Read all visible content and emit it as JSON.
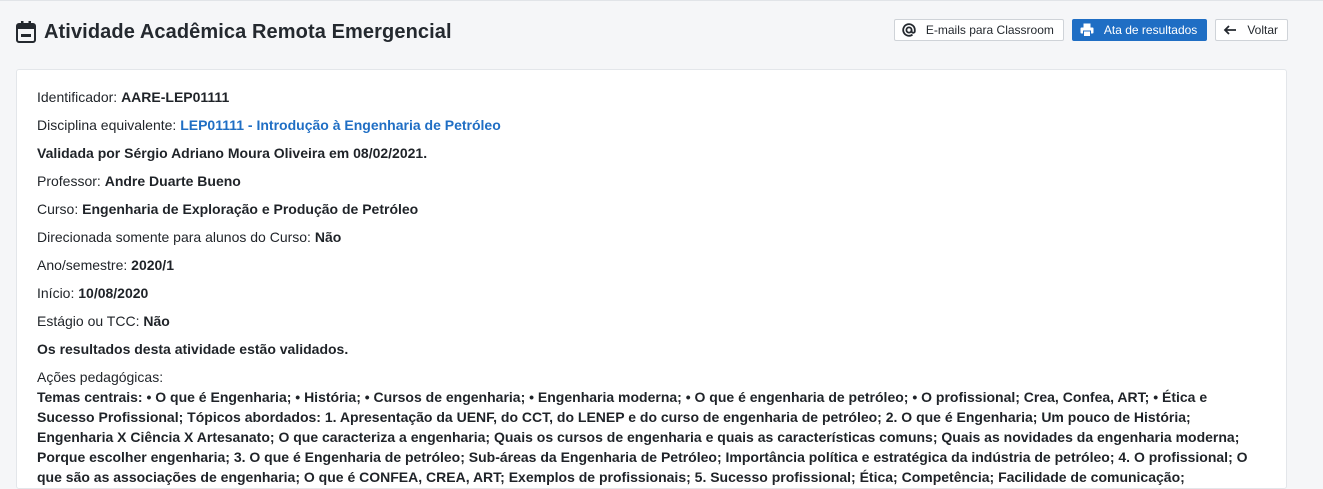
{
  "header": {
    "title": "Atividade Acadêmica Remota Emergencial",
    "title_icon": "calendar-icon"
  },
  "toolbar": {
    "emails_label": "E-mails para Classroom",
    "emails_icon": "at-icon",
    "ata_label": "Ata de resultados",
    "ata_icon": "printer-icon",
    "voltar_label": "Voltar",
    "voltar_icon": "arrow-left-icon"
  },
  "details": {
    "identificador_label": "Identificador:",
    "identificador_value": "AARE-LEP01111",
    "disciplina_label": "Disciplina equivalente:",
    "disciplina_value": "LEP01111 - Introdução à Engenharia de Petróleo",
    "validada": "Validada por Sérgio Adriano Moura Oliveira em 08/02/2021.",
    "professor_label": "Professor:",
    "professor_value": "Andre Duarte Bueno",
    "curso_label": "Curso:",
    "curso_value": "Engenharia de Exploração e Produção de Petróleo",
    "direcionada_label": "Direcionada somente para alunos do Curso:",
    "direcionada_value": "Não",
    "ano_label": "Ano/semestre:",
    "ano_value": "2020/1",
    "inicio_label": "Início:",
    "inicio_value": "10/08/2020",
    "estagio_label": "Estágio ou TCC:",
    "estagio_value": "Não",
    "resultados": "Os resultados desta atividade estão validados.",
    "acoes_label": "Ações pedagógicas:",
    "acoes_text": "Temas centrais: • O que é Engenharia; • História; • Cursos de engenharia; • Engenharia moderna; • O que é engenharia de petróleo; • O profissional; Crea, Confea, ART; • Ética e Sucesso Profissional; Tópicos abordados: 1. Apresentação da UENF, do CCT, do LENEP e do curso de engenharia de petróleo; 2. O que é Engenharia; Um pouco de História; Engenharia X Ciência X Artesanato; O que caracteriza a engenharia; Quais os cursos de engenharia e quais as características comuns; Quais as novidades da engenharia moderna; Porque escolher engenharia; 3. O que é Engenharia de petróleo; Sub-áreas da Engenharia de Petróleo; Importância política e estratégica da indústria de petróleo; 4. O profissional; O que são as associações de engenharia; O que é CONFEA, CREA, ART; Exemplos de profissionais; 5. Sucesso profissional; Ética; Competência; Facilidade de comunicação;"
  },
  "colors": {
    "link": "#1f6ec4",
    "primary_button": "#1f6ec4",
    "background": "#f5f6f8"
  }
}
